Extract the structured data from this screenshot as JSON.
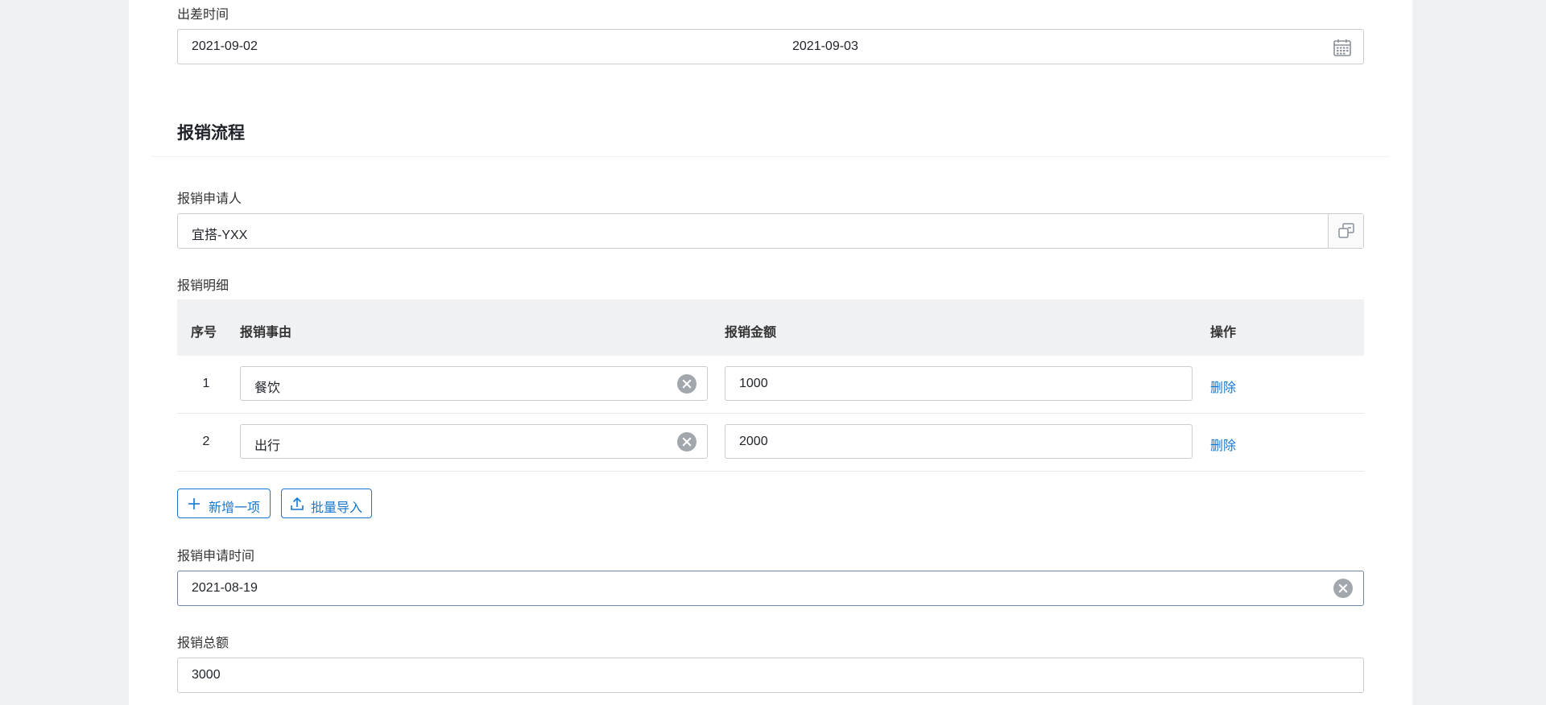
{
  "colors": {
    "accent": "#1677d2",
    "border": "#c9ccd1",
    "header_bg": "#f0f1f3"
  },
  "trip": {
    "label": "出差时间",
    "start": "2021-09-02",
    "separator": "-",
    "end": "2021-09-03",
    "icon": "calendar-icon"
  },
  "process": {
    "title": "报销流程"
  },
  "applicant": {
    "label": "报销申请人",
    "value": "宜搭-YXX",
    "icon": "select-member-icon"
  },
  "details": {
    "label": "报销明细",
    "columns": [
      "序号",
      "报销事由",
      "报销金额",
      "操作"
    ],
    "rows": [
      {
        "index": "1",
        "reason": "餐饮",
        "amount": "1000",
        "action": "删除"
      },
      {
        "index": "2",
        "reason": "出行",
        "amount": "2000",
        "action": "删除"
      }
    ],
    "add_label": "新增一项",
    "import_label": "批量导入"
  },
  "apply_time": {
    "label": "报销申请时间",
    "value": "2021-08-19"
  },
  "total": {
    "label": "报销总额",
    "value": "3000"
  }
}
